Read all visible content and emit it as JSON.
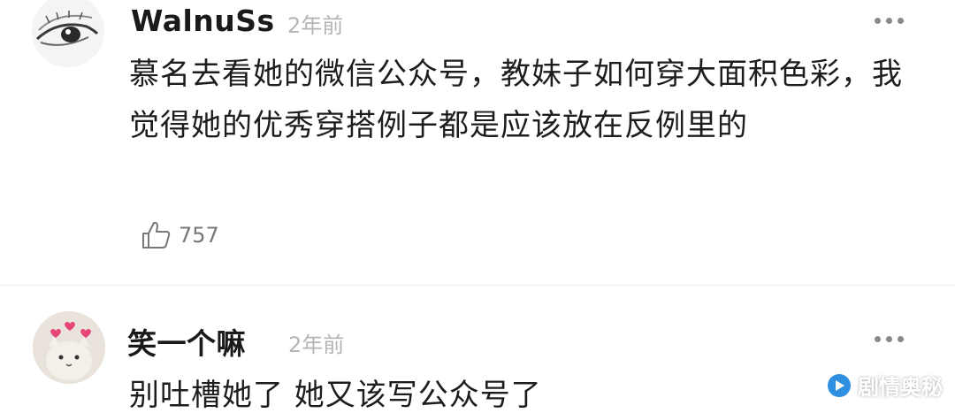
{
  "comments": [
    {
      "username": "WalnuSs",
      "time": "2年前",
      "text": "慕名去看她的微信公众号，教妹子如何穿大面积色彩，我觉得她的优秀穿搭例子都是应该放在反例里的",
      "likes": "757",
      "avatar_icon": "eye-sketch-avatar"
    },
    {
      "username": "笑一个嘛",
      "time": "2年前",
      "text": "别吐槽她了 她又该写公众号了",
      "avatar_icon": "cat-with-hearts-avatar"
    }
  ],
  "watermark": {
    "text": "剧情奥秘",
    "color": "#2f8fe0"
  }
}
